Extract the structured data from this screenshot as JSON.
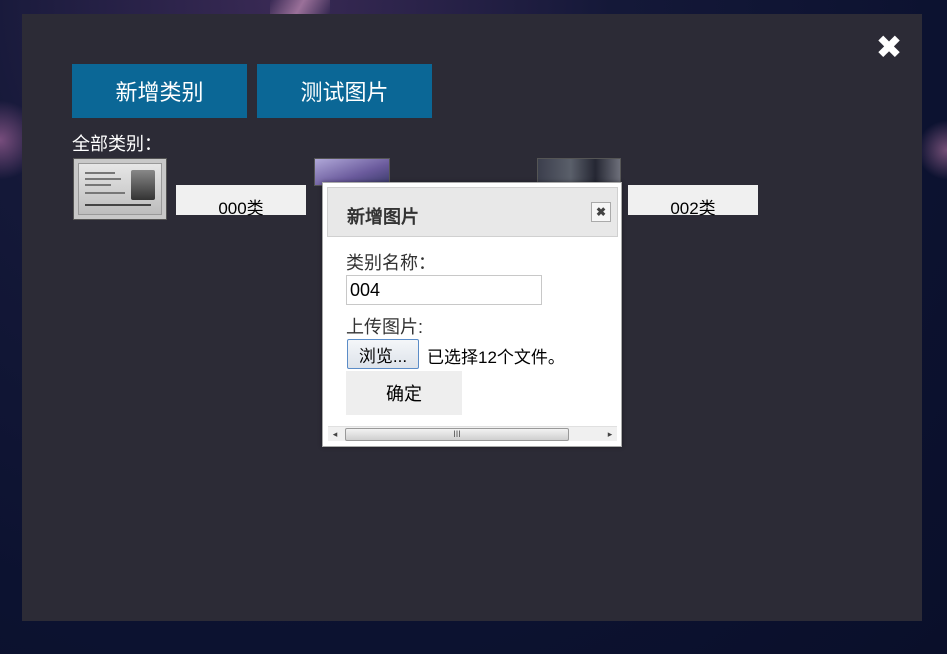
{
  "window": {
    "close_icon": "close-icon",
    "close_glyph": "✖"
  },
  "toolbar": {
    "add_category_label": "新增类别",
    "test_image_label": "测试图片"
  },
  "categories": {
    "heading": "全部类别：",
    "items": [
      {
        "label": "000类",
        "thumbnail": "id-card-image"
      },
      {
        "label": "",
        "thumbnail": "purple-landscape-image"
      },
      {
        "label": "002类",
        "thumbnail": "street-scene-image"
      }
    ]
  },
  "dialog": {
    "title": "新增图片",
    "close_glyph": "✖",
    "category_name_label": "类别名称：",
    "category_name_value": "004",
    "upload_label": "上传图片:",
    "browse_label": "浏览...",
    "file_status": "已选择12个文件。",
    "confirm_label": "确定",
    "scroll_left": "◂",
    "scroll_right": "▸",
    "scroll_grip": "III"
  },
  "colors": {
    "panel_bg": "#2c2b36",
    "button_blue": "#0b6796",
    "page_bg": "#0c1230"
  }
}
